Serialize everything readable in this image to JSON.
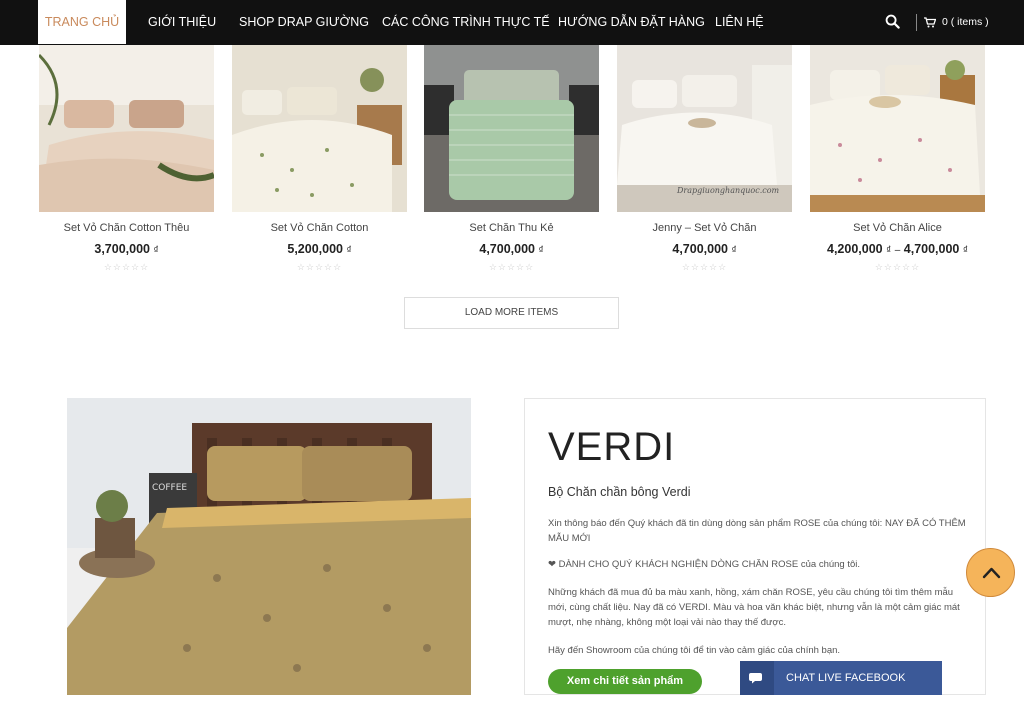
{
  "nav": {
    "items": [
      {
        "label": "TRANG CHỦ",
        "active": true
      },
      {
        "label": "GIỚI THIỆU"
      },
      {
        "label": "SHOP DRAP GIƯỜNG"
      },
      {
        "label": "CÁC CÔNG TRÌNH THỰC TẾ"
      },
      {
        "label": "HƯỚNG DẪN ĐẶT HÀNG"
      },
      {
        "label": "LIÊN HỆ"
      }
    ],
    "cart_label": "0 ( items )"
  },
  "products": [
    {
      "name": "Set Vỏ Chăn Cotton Thêu",
      "price": "3,700,000",
      "currency": "₫"
    },
    {
      "name": "Set Vỏ Chăn Cotton",
      "price": "5,200,000",
      "currency": "₫"
    },
    {
      "name": "Set Chăn Thu Kẻ",
      "price": "4,700,000",
      "currency": "₫"
    },
    {
      "name": "Jenny – Set Vỏ Chăn",
      "price": "4,700,000",
      "currency": "₫",
      "watermark": "Drapgiuonghanquoc.com"
    },
    {
      "name": "Set Vỏ Chăn Alice",
      "price": "4,200,000",
      "price_max": "4,700,000",
      "currency": "₫",
      "range_sep": "–"
    }
  ],
  "load_more_label": "LOAD MORE ITEMS",
  "feature": {
    "coffee_sign": "COFFEE",
    "title": "VERDI",
    "subtitle": "Bộ Chăn chần bông Verdi",
    "p1": "Xin thông báo đến Quý khách đã tin dùng dòng sản phẩm ROSE của chúng tôi: NAY ĐÃ CÓ THÊM MẪU MỚI",
    "p2": "❤ DÀNH CHO QUÝ KHÁCH NGHIỆN DÒNG CHĂN ROSE của chúng tôi.",
    "p3": "Những khách đã mua đủ ba màu xanh, hồng, xám chăn ROSE, yêu cầu chúng tôi tìm thêm mẫu mới, cùng chất liệu. Nay đã có VERDI. Màu và hoa văn khác biệt, nhưng vẫn là một cảm giác mát mượt, nhẹ nhàng, không một loại vải nào thay thế được.",
    "p4": "Hãy đến Showroom của chúng tôi để tin vào cảm giác của chính bạn.",
    "button": "Xem chi tiết sản phẩm"
  },
  "chat_label": "CHAT LIVE FACEBOOK",
  "colors": {
    "nav_bg": "#111111",
    "active": "#c98a5c",
    "green_button": "#4ea12d",
    "facebook": "#3b5998",
    "totop": "#f5b45a"
  }
}
